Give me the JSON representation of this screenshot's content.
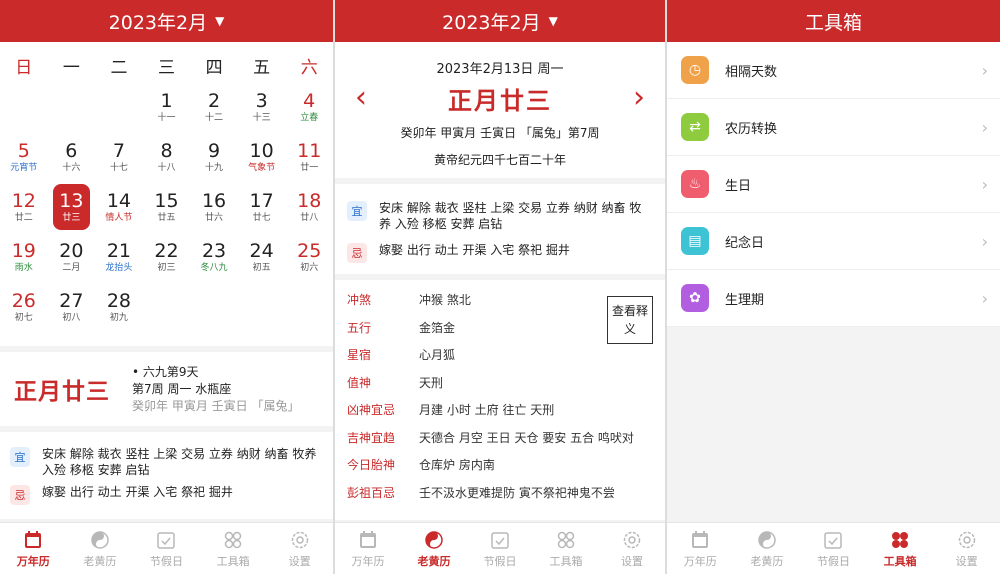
{
  "panel1": {
    "header": {
      "title": "2023年2月"
    },
    "weekdays": [
      "日",
      "一",
      "二",
      "三",
      "四",
      "五",
      "六"
    ],
    "weeks": [
      [
        null,
        null,
        null,
        {
          "d": "1",
          "s": "十一"
        },
        {
          "d": "2",
          "s": "十二"
        },
        {
          "d": "3",
          "s": "十三"
        },
        {
          "d": "4",
          "s": "立春",
          "sc": "green"
        }
      ],
      [
        {
          "d": "5",
          "s": "元宵节",
          "sc": "blue"
        },
        {
          "d": "6",
          "s": "十六"
        },
        {
          "d": "7",
          "s": "十七"
        },
        {
          "d": "8",
          "s": "十八"
        },
        {
          "d": "9",
          "s": "十九"
        },
        {
          "d": "10",
          "s": "气象节",
          "sc": "red"
        },
        {
          "d": "11",
          "s": "廿一"
        }
      ],
      [
        {
          "d": "12",
          "s": "廿二"
        },
        {
          "d": "13",
          "s": "廿三",
          "sel": true
        },
        {
          "d": "14",
          "s": "情人节",
          "sc": "red"
        },
        {
          "d": "15",
          "s": "廿五"
        },
        {
          "d": "16",
          "s": "廿六"
        },
        {
          "d": "17",
          "s": "廿七"
        },
        {
          "d": "18",
          "s": "廿八"
        }
      ],
      [
        {
          "d": "19",
          "s": "雨水",
          "sc": "green"
        },
        {
          "d": "20",
          "s": "二月"
        },
        {
          "d": "21",
          "s": "龙抬头",
          "sc": "blue"
        },
        {
          "d": "22",
          "s": "初三"
        },
        {
          "d": "23",
          "s": "冬八九",
          "sc": "green"
        },
        {
          "d": "24",
          "s": "初五"
        },
        {
          "d": "25",
          "s": "初六"
        }
      ],
      [
        {
          "d": "26",
          "s": "初七"
        },
        {
          "d": "27",
          "s": "初八"
        },
        {
          "d": "28",
          "s": "初九"
        },
        null,
        null,
        null,
        null
      ]
    ],
    "info": {
      "lunar": "正月廿三",
      "line1": "• 六九第9天",
      "line2": "第7周 周一   水瓶座",
      "line3": "癸卯年   甲寅月   壬寅日   「属兔」"
    },
    "yi_label": "宜",
    "yi": "安床 解除 裁衣 竖柱 上梁 交易 立券 纳财 纳畜 牧养 入殓 移柩 安葬 启钻",
    "ji_label": "忌",
    "ji": "嫁娶 出行 动土 开渠 入宅 祭祀 掘井"
  },
  "panel2": {
    "header": {
      "title": "2023年2月"
    },
    "date": "2023年2月13日  周一",
    "lunar": "正月廿三",
    "prev": "‹",
    "next": "›",
    "ganzhi": "癸卯年   甲寅月   壬寅日   「属兔」第7周",
    "huangdi": "黄帝纪元四千七百二十年",
    "yi_label": "宜",
    "yi": "安床 解除 裁衣 竖柱 上梁 交易 立券 纳财 纳畜 牧养 入殓 移柩 安葬 启钻",
    "ji_label": "忌",
    "ji": "嫁娶 出行 动土 开渠 入宅 祭祀 掘井",
    "details": [
      {
        "k": "冲煞",
        "v": "冲猴 煞北"
      },
      {
        "k": "五行",
        "v": "金箔金"
      },
      {
        "k": "星宿",
        "v": "心月狐"
      },
      {
        "k": "值神",
        "v": "天刑"
      },
      {
        "k": "凶神宜忌",
        "v": "月建 小时 土府 往亡 天刑"
      },
      {
        "k": "吉神宜趋",
        "v": "天德合 月空 王日 天仓 要安 五合 鸣吠对"
      },
      {
        "k": "今日胎神",
        "v": "仓库炉 房内南"
      },
      {
        "k": "彭祖百忌",
        "v": "壬不汲水更难提防 寅不祭祀神鬼不尝"
      }
    ],
    "explain_btn": "查看释义"
  },
  "panel3": {
    "header": {
      "title": "工具箱"
    },
    "tools": [
      {
        "label": "相隔天数",
        "icon": "clock-icon",
        "color": "#f0a24a",
        "glyph": "◷"
      },
      {
        "label": "农历转换",
        "icon": "swap-icon",
        "color": "#8fcb3f",
        "glyph": "⇄"
      },
      {
        "label": "生日",
        "icon": "cake-icon",
        "color": "#ef5d6e",
        "glyph": "♨"
      },
      {
        "label": "纪念日",
        "icon": "calendar-icon",
        "color": "#3ec3d5",
        "glyph": "▤"
      },
      {
        "label": "生理期",
        "icon": "flower-icon",
        "color": "#b15ee0",
        "glyph": "✿"
      }
    ]
  },
  "tabs": [
    {
      "label": "万年历",
      "icon": "calendar-icon"
    },
    {
      "label": "老黄历",
      "icon": "yinyang-icon"
    },
    {
      "label": "节假日",
      "icon": "holiday-icon"
    },
    {
      "label": "工具箱",
      "icon": "toolbox-icon"
    },
    {
      "label": "设置",
      "icon": "settings-icon"
    }
  ],
  "colors": {
    "accent": "#cb2a2b"
  }
}
